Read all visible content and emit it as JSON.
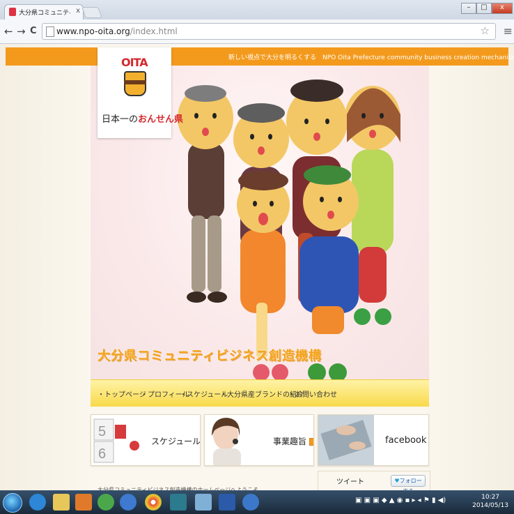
{
  "browser": {
    "tab_title": "大分県コミュニティビジネ",
    "tab_close": "x",
    "url_host": "www.npo-oita.org",
    "url_path": "/index.html",
    "back_icon": "←",
    "forward_icon": "→",
    "reload_icon": "C",
    "star_icon": "☆",
    "menu_icon": "≡",
    "minimize": "–",
    "maximize": "□",
    "close": "x"
  },
  "site": {
    "tagline": "新しい視点で大分を明るくする　NPO Oita Prefecture community business creation mechanism",
    "logo_mark": "OITA",
    "logo_text_plain": "日本一の",
    "logo_text_red": "おんせん県",
    "hero_title": "大分県コミュニティビジネス創造機構",
    "menu": [
      "・トップページ",
      "・プロフィール",
      "・スケジュール",
      "・大分県産ブランドの紹介",
      "・お問い合わせ"
    ],
    "cards": [
      {
        "label": "スケジュール"
      },
      {
        "label": "事業趣旨"
      },
      {
        "label": "facebook"
      }
    ],
    "bottom_text": "大分県コミュニティビジネス創造機構のホームページへようこそ。",
    "tweet_label": "ツイート",
    "follow_label": "フォロー する"
  },
  "taskbar": {
    "time": "10:27",
    "date": "2014/05/13"
  }
}
